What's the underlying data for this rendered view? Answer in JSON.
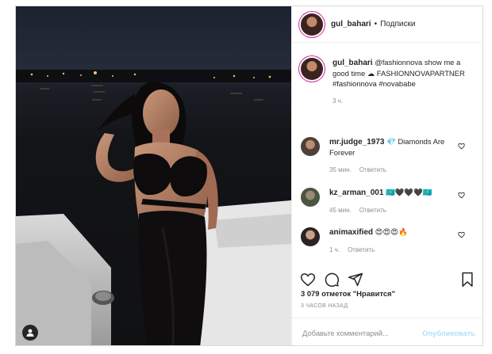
{
  "header": {
    "username": "gul_bahari",
    "separator": "•",
    "follow_label": "Подписки"
  },
  "caption": {
    "username": "gul_bahari",
    "text": "@fashionnova show me a good time ☁ FASHIONNOVAPARTNER #fashionnova #novababe",
    "time": "3 ч."
  },
  "comments": [
    {
      "username": "mr.judge_1973",
      "text": "💎 Diamonds Are Forever",
      "time": "35 мин.",
      "reply": "Ответить"
    },
    {
      "username": "kz_arman_001",
      "text": "🇰🇿🖤🖤🖤🇰🇿",
      "time": "45 мин.",
      "reply": "Ответить"
    },
    {
      "username": "animaxified",
      "text": "😍😍😍🔥",
      "time": "1 ч.",
      "reply": "Ответить"
    }
  ],
  "likes": "3 079 отметок \"Нравится\"",
  "post_time": "3 ЧАСОВ НАЗАД",
  "add_comment": {
    "placeholder": "Добавьте комментарий...",
    "publish_label": "Опубликовать"
  },
  "icons": [
    "heart-icon",
    "comment-icon",
    "share-icon",
    "bookmark-icon",
    "user-tag-icon"
  ],
  "colors": {
    "username": "#262626",
    "muted": "#8e8e8e",
    "publish": "#b2dffc",
    "story_ring": "#d6249f"
  }
}
